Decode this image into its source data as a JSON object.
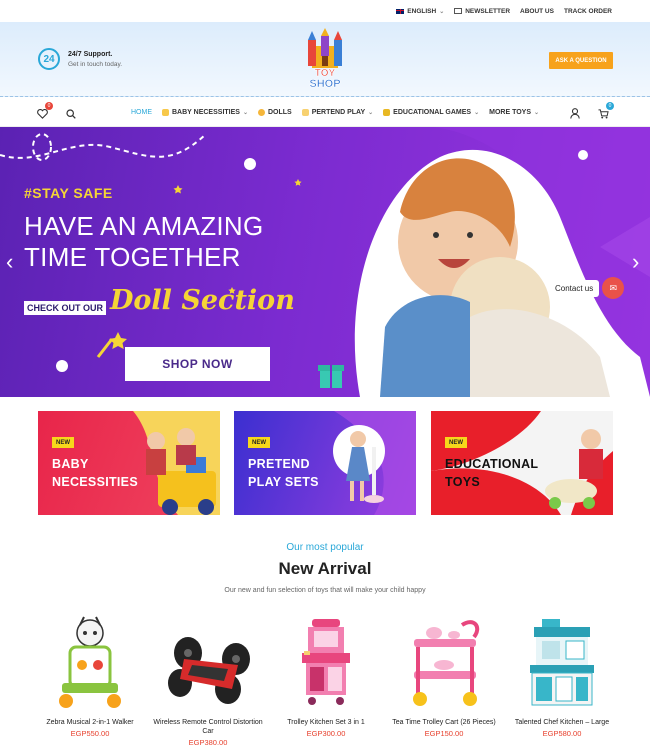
{
  "topbar": {
    "language": "ENGLISH",
    "newsletter": "NEWSLETTER",
    "about": "ABOUT US",
    "track": "TRACK ORDER"
  },
  "header": {
    "support_title": "24/7 Support.",
    "support_sub": "Get in touch today.",
    "logo_top": "TOY",
    "logo_bottom": "SHOP",
    "ask_button": "ASK A QUESTION"
  },
  "nav": {
    "wishlist_count": "0",
    "cart_count": "0",
    "items": [
      {
        "label": "HOME",
        "icon": "none"
      },
      {
        "label": "BABY NECESSITIES",
        "icon": "bottle-icon"
      },
      {
        "label": "DOLLS",
        "icon": "doll-icon"
      },
      {
        "label": "PERTEND PLAY",
        "icon": "play-icon"
      },
      {
        "label": "EDUCATIONAL GAMES",
        "icon": "blocks-icon"
      },
      {
        "label": "MORE TOYS",
        "icon": "none"
      }
    ]
  },
  "hero": {
    "tag": "#STAY SAFE",
    "headline_1": "HAVE AN AMAZING",
    "headline_2": "TIME TOGETHER",
    "checkout": "CHECK OUT OUR",
    "doll": "Doll Section",
    "button": "SHOP NOW",
    "contact": "Contact us"
  },
  "banners": [
    {
      "badge": "NEW",
      "line1": "BABY",
      "line2": "NECESSITIES"
    },
    {
      "badge": "NEW",
      "line1": "PRETEND",
      "line2": "PLAY SETS"
    },
    {
      "badge": "NEW",
      "line1": "EDUCATIONAL",
      "line2": "TOYS"
    }
  ],
  "arrival": {
    "kicker": "Our most popular",
    "title": "New Arrival",
    "subtitle": "Our new and fun selection of toys that will make your child happy"
  },
  "products": [
    {
      "name": "Zebra Musical 2-in-1 Walker",
      "price": "EGP550.00"
    },
    {
      "name": "Wireless Remote Control Distortion Car",
      "price": "EGP380.00"
    },
    {
      "name": "Trolley Kitchen Set 3 in 1",
      "price": "EGP300.00"
    },
    {
      "name": "Tea Time Trolley Cart (26 Pieces)",
      "price": "EGP150.00"
    },
    {
      "name": "Talented Chef Kitchen – Large",
      "price": "EGP580.00"
    }
  ]
}
